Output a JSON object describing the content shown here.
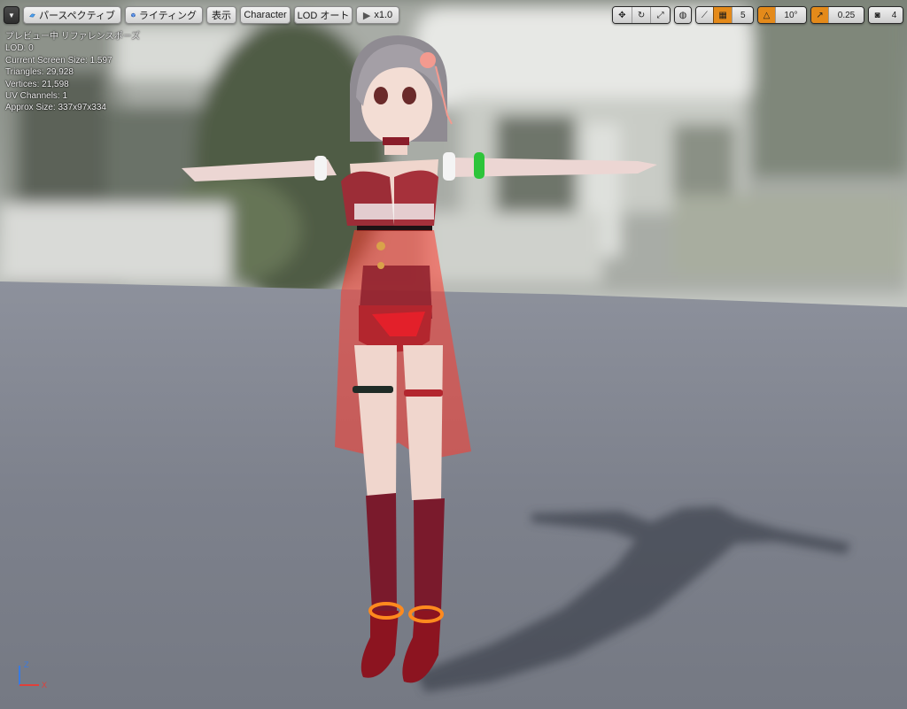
{
  "toolbar": {
    "dropdown_icon": "chevron-down-icon",
    "perspective_label": "パースペクティブ",
    "lighting_label": "ライティング",
    "show_label": "表示",
    "character_label": "Character",
    "lod_label": "LOD オート",
    "speed_label": "x1.0",
    "grid_snap_value": "5",
    "rotation_snap_value": "10°",
    "scale_snap_value": "0.25",
    "camera_speed_value": "4"
  },
  "stats": {
    "preview_label": "プレビュー中 リファレンスポーズ",
    "lod": "LOD: 0",
    "screen_size": "Current Screen Size: 1.597",
    "triangles": "Triangles: 29,928",
    "vertices": "Vertices: 21,598",
    "uv_channels": "UV Channels: 1",
    "approx_size": "Approx Size: 337x97x334"
  },
  "gizmo": {
    "z_label": "Z",
    "x_label": "X"
  },
  "colors": {
    "toolbar_accent": "#e48a1a",
    "axis_x": "#e0403a",
    "axis_z": "#3a7be0"
  }
}
